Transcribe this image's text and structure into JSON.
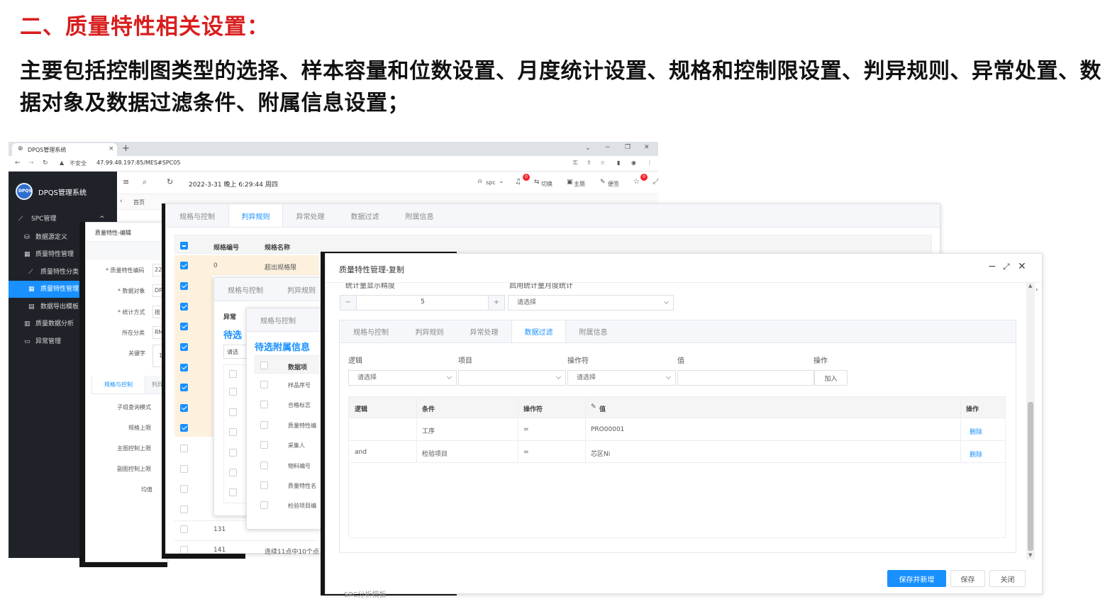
{
  "heading": "二、质量特性相关设置：",
  "description": "主要包括控制图类型的选择、样本容量和位数设置、月度统计设置、规格和控制限设置、判异规则、异常处置、数据对象及数据过滤条件、附属信息设置；",
  "browser": {
    "tab_title": "DPQS管理系统",
    "security_label": "不安全",
    "url": "47.99.48.197:85/MES#SPC05"
  },
  "app": {
    "brand": "DPQS管理系统",
    "logo_text": "DPQS",
    "datetime": "2022-3-31 晚上 6:29:44 周四",
    "user": "spc",
    "notice_count": "0",
    "star_count": "0",
    "actions": {
      "switch": "切换",
      "theme": "主题",
      "note": "便签"
    },
    "breadcrumb_home": "首页"
  },
  "sidebar": {
    "items": [
      {
        "label": "SPC管理",
        "icon": "chart-line-icon",
        "active": false
      },
      {
        "label": "数据源定义",
        "icon": "database-icon",
        "active": false
      },
      {
        "label": "质量特性管理",
        "icon": "grid-icon",
        "active": false
      },
      {
        "label": "质量特性分类",
        "icon": "chart-icon",
        "active": false
      },
      {
        "label": "质量特性管理",
        "icon": "grid-icon",
        "active": true
      },
      {
        "label": "数据导出模板",
        "icon": "file-icon",
        "active": false
      },
      {
        "label": "质量数据分析",
        "icon": "bar-chart-icon",
        "active": false
      },
      {
        "label": "异常管理",
        "icon": "folder-icon",
        "active": false
      }
    ]
  },
  "edit_window": {
    "title": "质量特性-编辑",
    "fields": [
      {
        "label": "* 质量特性编码",
        "value": "22("
      },
      {
        "label": "* 数据对象",
        "value": "DP"
      },
      {
        "label": "* 统计方式",
        "value": "按"
      },
      {
        "label": "所在分类",
        "value": "RM"
      },
      {
        "label": "关键字",
        "value": "1"
      }
    ],
    "tabs": [
      "规格与控制",
      "判异"
    ],
    "sub_fields": [
      "子组查询模式",
      "规格上限",
      "主图控制上限",
      "副图控制上限",
      "均值"
    ]
  },
  "rules_window": {
    "tabs": [
      "规格与控制",
      "判异规则",
      "异常处理",
      "数据过滤",
      "附属信息"
    ],
    "active_tab": 1,
    "columns": [
      "规格编号",
      "规格名称"
    ],
    "first_row": {
      "code": "0",
      "name": "超出规格限"
    },
    "bottom_rows": [
      {
        "code": "131",
        "name": ""
      },
      {
        "code": "141",
        "name": "连续11点中10个点"
      }
    ]
  },
  "anomaly_window": {
    "tabs": [
      "规格与控制",
      "判异规则"
    ],
    "section": "异常",
    "pending": "待选",
    "select_placeholder": "请选"
  },
  "attach_window": {
    "tab": "规格与控制",
    "title": "待选附属信息",
    "column": "数据项",
    "items": [
      "样品序号",
      "合格标志",
      "质量特性编",
      "采集人",
      "物料编号",
      "质量特性名",
      "检验项目编"
    ]
  },
  "copy_dialog": {
    "title": "质量特性管理-复制",
    "cut_labels": {
      "left": "统计量显示精度",
      "right": "启用统计量月度统计"
    },
    "stepper_value": "5",
    "stepper_minus": "−",
    "stepper_plus": "+",
    "monthly_placeholder": "请选择",
    "tabs": [
      "规格与控制",
      "判异规则",
      "异常处理",
      "数据过滤",
      "附属信息"
    ],
    "active_tab": 3,
    "filter_headers": [
      "逻辑",
      "项目",
      "操作符",
      "值",
      "操作"
    ],
    "filter_placeholders": {
      "logic": "请选择",
      "item": "",
      "operator": "请选择"
    },
    "add_button": "加入",
    "table_headers": [
      "逻辑",
      "条件",
      "操作符",
      "值",
      "操作"
    ],
    "rows": [
      {
        "logic": "",
        "condition": "工序",
        "operator": "=",
        "value": "PRO00001",
        "action": "删除"
      },
      {
        "logic": "and",
        "condition": "检验项目",
        "operator": "=",
        "value": "芯区Ni",
        "action": "删除"
      }
    ],
    "buttons": {
      "save_new": "保存并新增",
      "save": "保存",
      "close": "关闭"
    },
    "footer_cut": "SPC分析模板"
  }
}
